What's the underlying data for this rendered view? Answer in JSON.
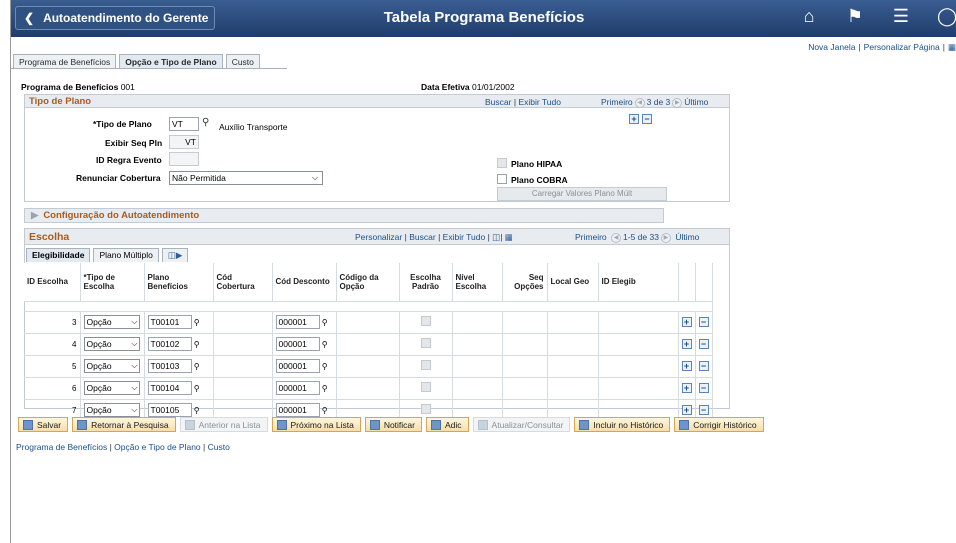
{
  "header": {
    "back_label": "Autoatendimento do Gerente",
    "title": "Tabela Programa Benefícios",
    "icons": [
      "home-icon",
      "flag-icon",
      "menu-icon",
      "compass-icon"
    ]
  },
  "top_links": {
    "new_window": "Nova Janela",
    "personalize": "Personalizar Página"
  },
  "tabs": [
    "Programa de Benefícios",
    "Opção e Tipo de Plano",
    "Custo"
  ],
  "program": {
    "label": "Programa de Benefícios",
    "value": "001",
    "eff_label": "Data Efetiva",
    "eff_value": "01/01/2002"
  },
  "plan_group": {
    "title": "Tipo de Plano",
    "search": "Buscar",
    "view_all": "Exibir Tudo",
    "first": "Primeiro",
    "count": "3 de 3",
    "last": "Último",
    "plan_type_label": "*Tipo de Plano",
    "plan_type_value": "VT",
    "plan_type_desc": "Auxílio Transporte",
    "seq_label": "Exibir Seq Pln",
    "seq_value": "VT",
    "rule_label": "ID Regra Evento",
    "rule_value": "",
    "waive_label": "Renunciar Cobertura",
    "waive_value": "Não Permitida",
    "hipaa_label": "Plano HIPAA",
    "cobra_label": "Plano COBRA",
    "load_button": "Carregar Valores Plano Múlt"
  },
  "config_group": {
    "title": "Configuração do Autoatendimento"
  },
  "choice_group": {
    "title": "Escolha",
    "personalize": "Personalizar",
    "search": "Buscar",
    "view_all": "Exibir Tudo",
    "first": "Primeiro",
    "count": "1-5 de 33",
    "last": "Último",
    "subtabs": [
      "Elegibilidade",
      "Plano Múltiplo"
    ],
    "columns": [
      "ID Escolha",
      "*Tipo de Escolha",
      "Plano Benefícios",
      "Cód Cobertura",
      "Cód Desconto",
      "Código da Opção",
      "Escolha Padrão",
      "Nível Escolha",
      "Seq Opções",
      "Local Geo",
      "ID Elegib"
    ],
    "rows": [
      {
        "id": "3",
        "type": "Opção",
        "plan": "T00101",
        "deduction": "000001"
      },
      {
        "id": "4",
        "type": "Opção",
        "plan": "T00102",
        "deduction": "000001"
      },
      {
        "id": "5",
        "type": "Opção",
        "plan": "T00103",
        "deduction": "000001"
      },
      {
        "id": "6",
        "type": "Opção",
        "plan": "T00104",
        "deduction": "000001"
      },
      {
        "id": "7",
        "type": "Opção",
        "plan": "T00105",
        "deduction": "000001"
      }
    ]
  },
  "toolbar": {
    "save": "Salvar",
    "return": "Retornar à Pesquisa",
    "prev": "Anterior na Lista",
    "next": "Próximo na Lista",
    "notify": "Notificar",
    "add": "Adic",
    "update": "Atualizar/Consultar",
    "history": "Incluir no Histórico",
    "correct": "Corrigir Histórico"
  },
  "bottom_links": [
    "Programa de Benefícios",
    "Opção e Tipo de Plano",
    "Custo"
  ]
}
